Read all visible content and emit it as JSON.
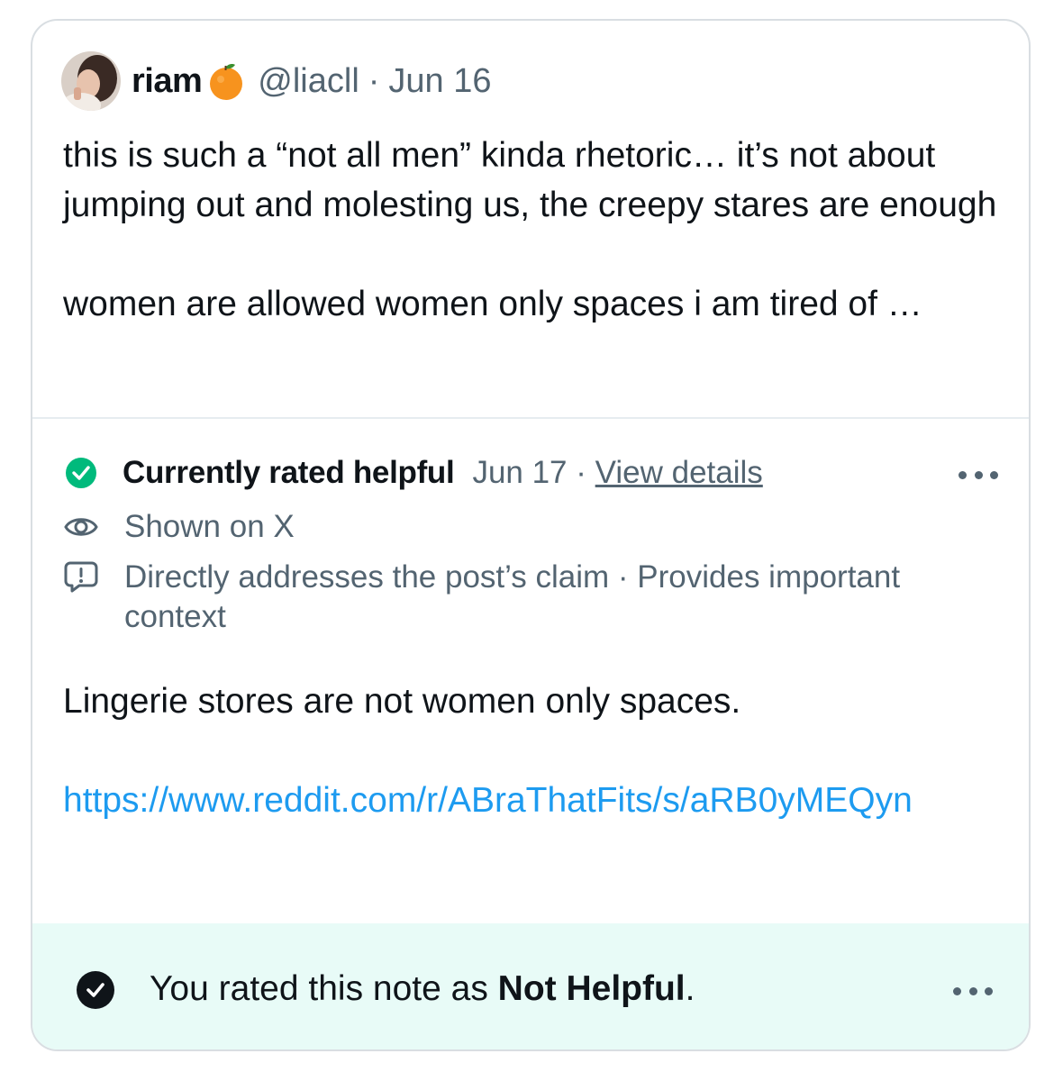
{
  "post": {
    "author_name": "riam",
    "author_badge_icon": "orange-fruit-icon",
    "handle": "@liacll",
    "separator": "·",
    "date": "Jun 16",
    "paragraphs": [
      "this is such a “not all men” kinda rhetoric… it’s not about jumping out and molesting us, the creepy stares are enough",
      "women are allowed women only spaces i am tired of …"
    ]
  },
  "note": {
    "status_label": "Currently rated helpful",
    "status_icon": "check-circle-icon",
    "status_color": "#00ba7c",
    "date": "Jun 17",
    "separator": "·",
    "details_link": "View details",
    "shown_label": "Shown on X",
    "reasons_label": "Directly addresses the post’s claim · Provides important context",
    "text": "Lingerie stores are not women only spaces.",
    "link": "https://www.reddit.com/r/ABraThatFits/s/aRB0yMEQyn",
    "link_color": "#1d9bf0"
  },
  "footer": {
    "prefix": "You rated this note as ",
    "rating": "Not Helpful",
    "suffix": ".",
    "background": "#e8fbf7"
  }
}
